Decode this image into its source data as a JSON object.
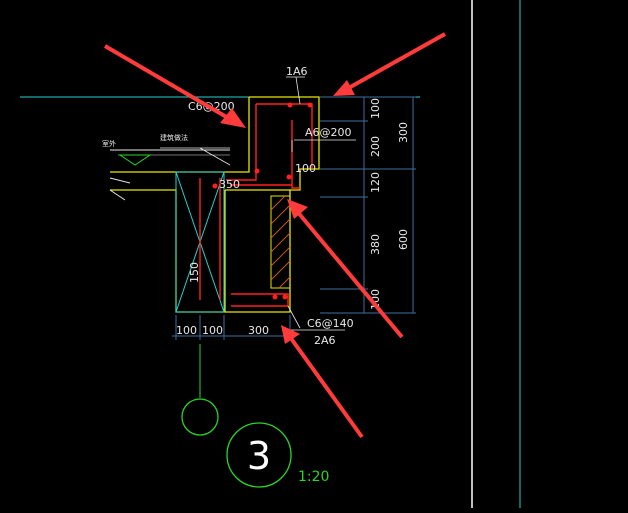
{
  "drawing": {
    "labels": {
      "top_bar": "1A6",
      "left_stirrup": "C6@200",
      "right_stirrup": "A6@200",
      "slab_callout": "350",
      "inner_dim": "100",
      "hatched_dim": "150",
      "bottom_stirrup": "C6@140",
      "bottom_bar": "2A6",
      "ground_tag": "室外",
      "slab_tag": "建筑做法"
    },
    "dims_right_inner": [
      "100",
      "200",
      "120",
      "380",
      "100"
    ],
    "dims_right_outer": [
      "300",
      "600"
    ],
    "dims_bottom": [
      "100",
      "100",
      "300"
    ],
    "section_number": "3",
    "scale": "1:20"
  },
  "colors": {
    "background": "#000000",
    "outline": "#e6e600",
    "rebar": "#ff2020",
    "dimension": "#e8e8e8",
    "dim_line": "#3d6fa0",
    "cyan": "#27d0d0",
    "green": "#2bd52b",
    "arrow": "#ff3b3b"
  }
}
